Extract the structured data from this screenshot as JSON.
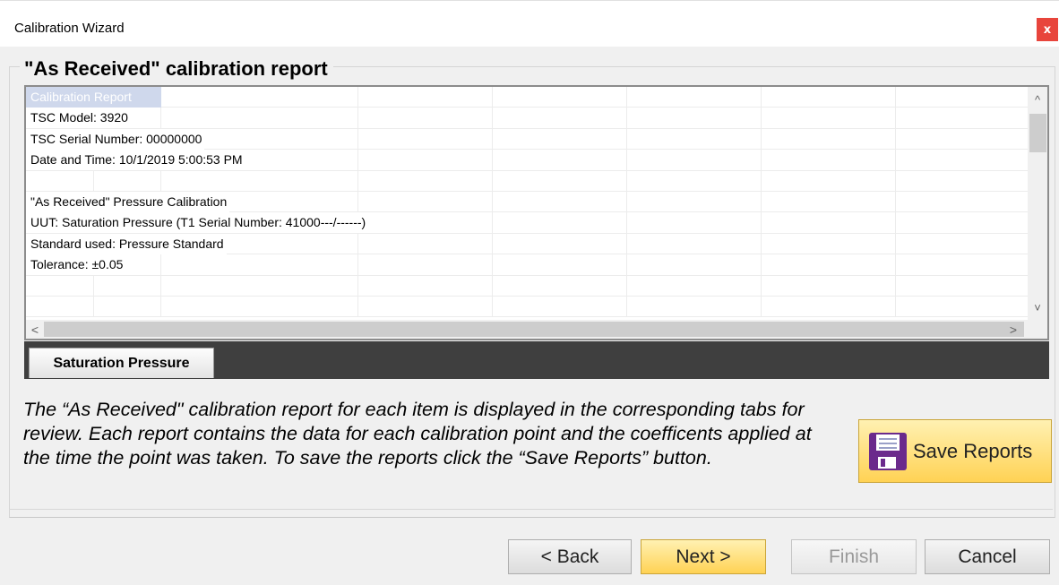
{
  "window": {
    "title": "Calibration Wizard",
    "close_glyph": "x"
  },
  "group": {
    "title": "\"As Received\" calibration report"
  },
  "report": {
    "rows": [
      "Calibration Report",
      "TSC Model: 3920",
      "TSC Serial Number: 00000000",
      "Date and Time: 10/1/2019 5:00:53 PM",
      "",
      "\"As Received\" Pressure Calibration",
      "UUT: Saturation Pressure (T1 Serial Number: 41000---/------)",
      "Standard used: Pressure Standard",
      "Tolerance: ±0.05"
    ]
  },
  "scroll": {
    "up": "^",
    "down": "˅",
    "left": "<",
    "right": ">"
  },
  "tabs": [
    {
      "label": "Saturation Pressure"
    }
  ],
  "description": "The “As Received\" calibration report for each item is displayed in the corresponding tabs for review.  Each report contains the data for each calibration point and the coefficents applied at the time the point was taken.  To save the reports click the “Save Reports” button.",
  "save_button": {
    "label": "Save Reports",
    "icon": "floppy-disk-icon"
  },
  "footer": {
    "back": "< Back",
    "next": "Next >",
    "finish": "Finish",
    "cancel": "Cancel"
  },
  "colors": {
    "accent": "#ffd254",
    "close": "#e8453c",
    "tab_strip": "#3f3f3f",
    "header_cell": "#cfd8ec",
    "save_icon": "#6b2a8c"
  }
}
